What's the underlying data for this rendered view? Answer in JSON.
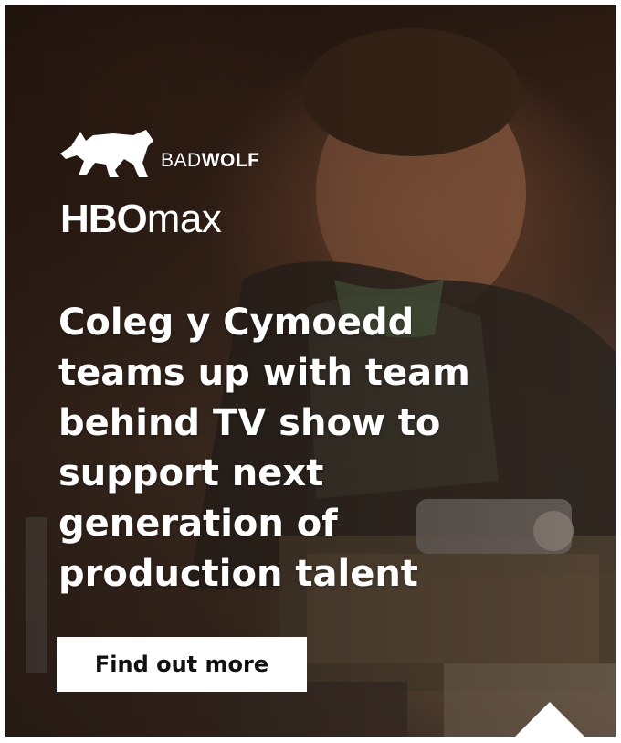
{
  "brand": {
    "badwolf_bold": "BAD",
    "badwolf_rest": "WOLF",
    "hbo": "HBO",
    "max": "max"
  },
  "headline": "Coleg y Cymoedd teams up with team behind TV show to support next generation of production talent",
  "cta": {
    "label": "Find out more"
  },
  "icons": {
    "wolf": "wolf-logo-icon",
    "notch": "triangle-up-icon"
  },
  "colors": {
    "text": "#ffffff",
    "button_bg": "#ffffff",
    "button_text": "#111111"
  }
}
